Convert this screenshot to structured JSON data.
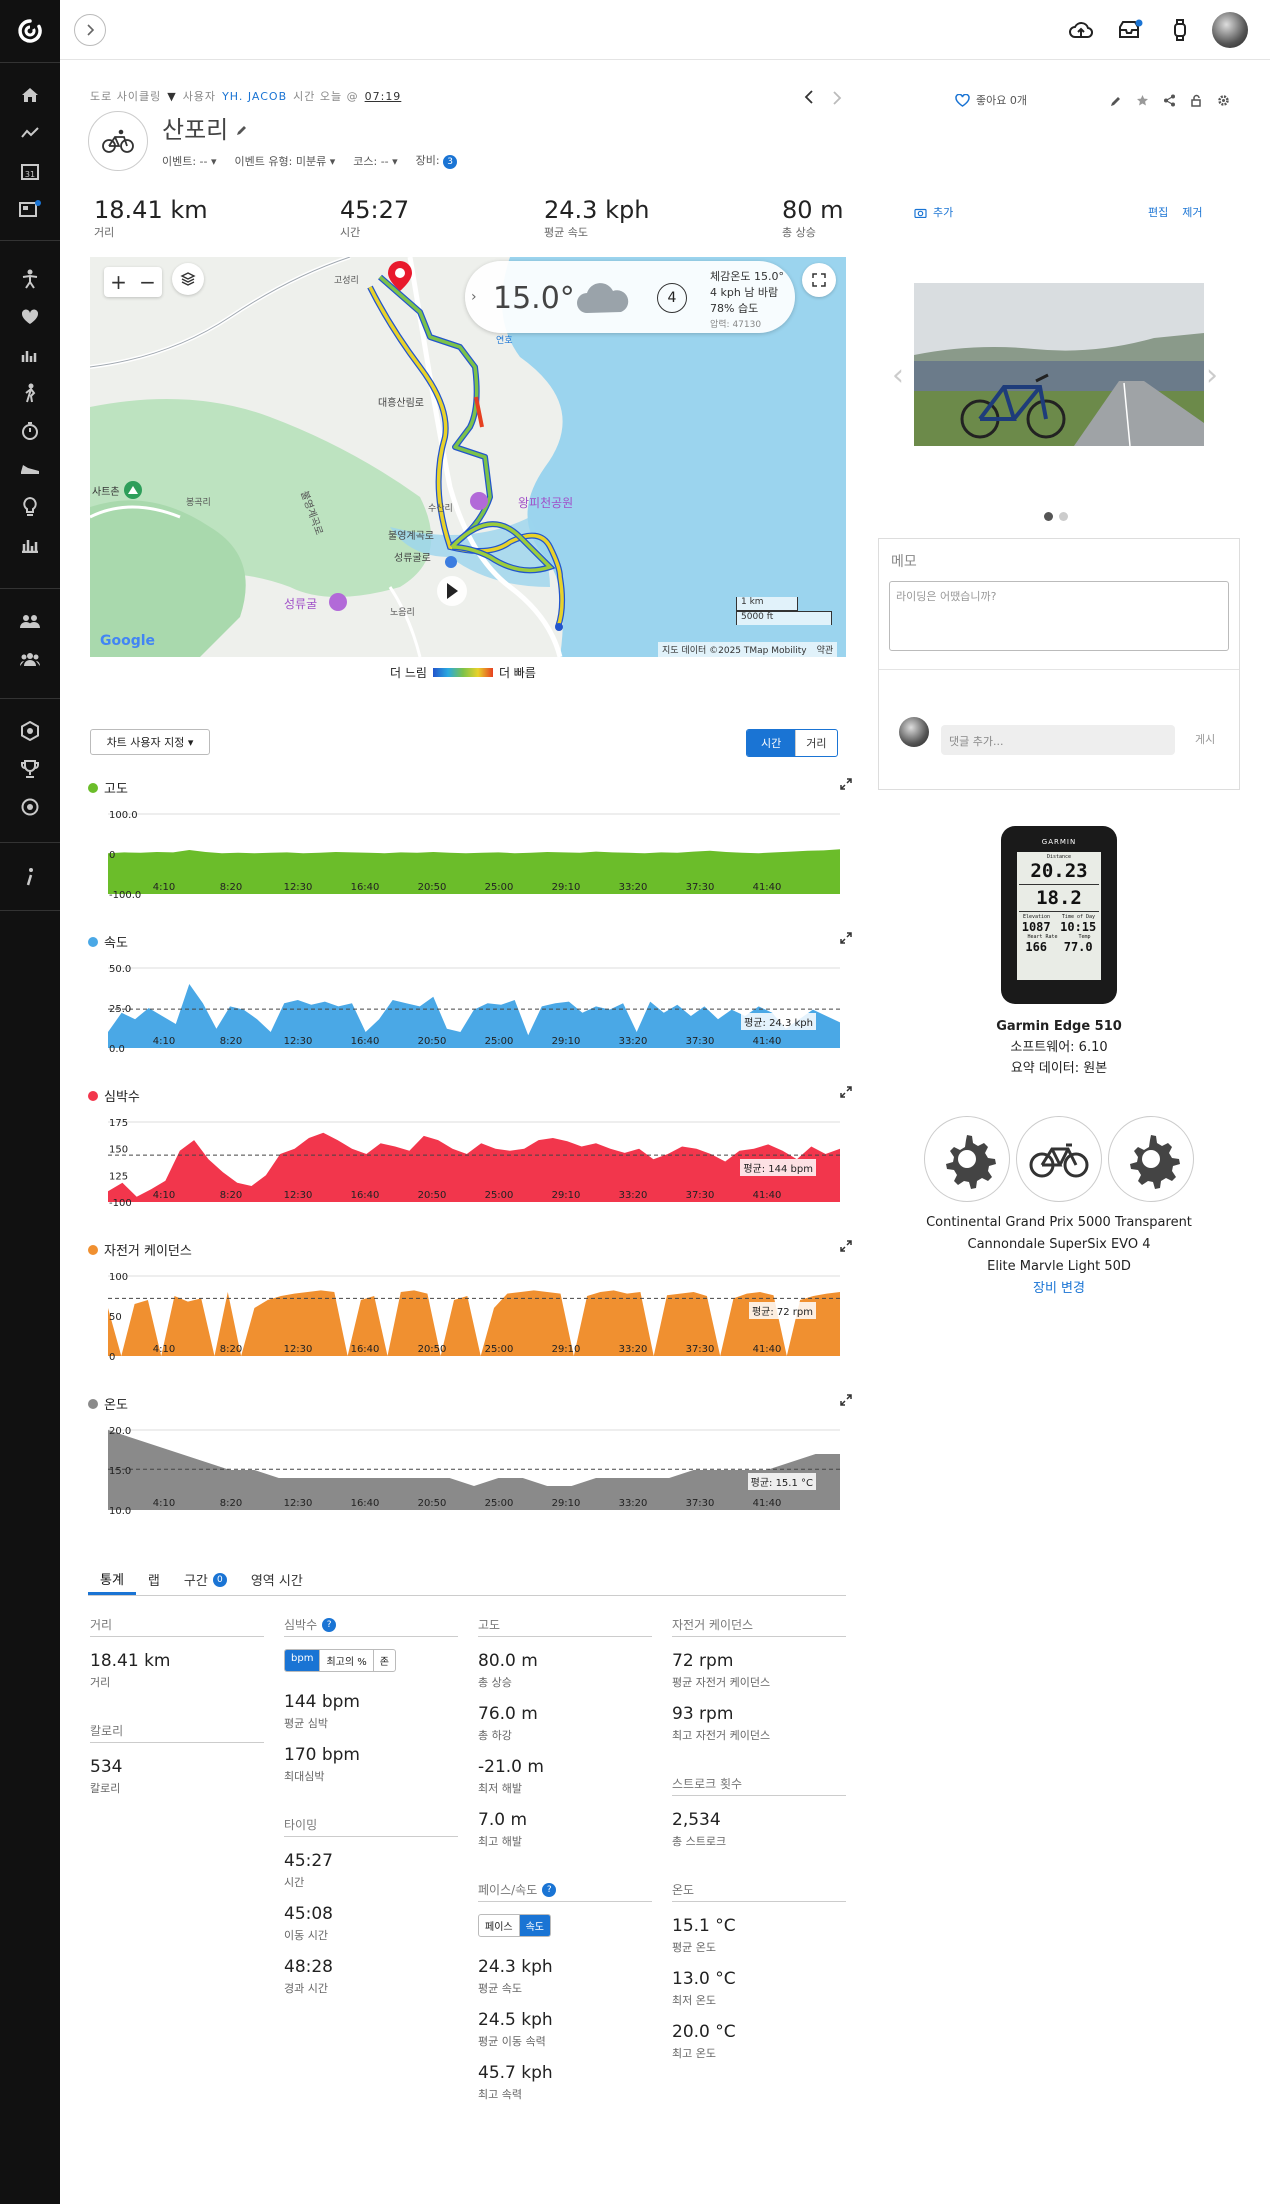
{
  "activity": {
    "breadcrumb_type": "도로 사이클링",
    "by_label": "사용자",
    "user": "YH. JACOB",
    "time_label": "시간 오늘 @",
    "time": "07:19",
    "title": "산포리",
    "event": "이벤트: --",
    "event_type": "이벤트 유형: 미분류",
    "course": "코스: --",
    "gear_label": "장비:",
    "gear_count": "3",
    "likes": "좋아요 0개"
  },
  "summary": [
    {
      "value": "18.41 km",
      "label": "거리"
    },
    {
      "value": "45:27",
      "label": "시간"
    },
    {
      "value": "24.3 kph",
      "label": "평균 속도"
    },
    {
      "value": "80 m",
      "label": "총 상승"
    }
  ],
  "weather": {
    "temp": "15.0°",
    "feels": "체감온도 15.0°",
    "wind": "4 kph 남 바람",
    "humidity": "78% 습도",
    "pressure": "압력: 47130",
    "wind_speed": "4"
  },
  "map": {
    "labels": [
      "고성리",
      "대흥산림로",
      "봉곡리",
      "사트촌",
      "불영계곡로",
      "불영계곡로",
      "성류굴로",
      "성류굴",
      "노음리",
      "왕피천공원",
      "수산리",
      "연호"
    ],
    "scale_km": "1 km",
    "scale_ft": "5000 ft",
    "attribution": "지도 데이터 ©2025 TMap Mobility",
    "terms": "약관",
    "google": "Google",
    "legend_slow": "더 느림",
    "legend_fast": "더 빠름"
  },
  "chart_controls": {
    "customize": "차트 사용자 지정 ▾",
    "time": "시간",
    "distance": "거리"
  },
  "chart_data": [
    {
      "type": "area",
      "title": "고도",
      "color": "#6bbd2a",
      "ymin": -100,
      "ymax": 100,
      "yticks": [
        "100.0",
        "0",
        "-100.0"
      ],
      "x_ticks": [
        "4:10",
        "8:20",
        "12:30",
        "16:40",
        "20:50",
        "25:00",
        "29:10",
        "33:20",
        "37:30",
        "41:40"
      ],
      "values": [
        2,
        4,
        3,
        5,
        4,
        10,
        5,
        2,
        3,
        2,
        3,
        4,
        2,
        3,
        5,
        4,
        3,
        2,
        4,
        3,
        5,
        3,
        2,
        3,
        4,
        2,
        3,
        5,
        4,
        3,
        6,
        4,
        3,
        2,
        4,
        3,
        6,
        8,
        5,
        3,
        2,
        4,
        6,
        8,
        9,
        12
      ]
    },
    {
      "type": "area",
      "title": "속도",
      "color": "#4aa8e6",
      "ymin": 0,
      "ymax": 50,
      "yticks": [
        "50.0",
        "25.0",
        "0.0"
      ],
      "avg": 24.3,
      "avg_label": "평균: 24.3 kph",
      "x_ticks": [
        "4:10",
        "8:20",
        "12:30",
        "16:40",
        "20:50",
        "25:00",
        "29:10",
        "33:20",
        "37:30",
        "41:40"
      ],
      "values": [
        10,
        22,
        18,
        25,
        20,
        15,
        40,
        28,
        12,
        26,
        24,
        18,
        10,
        28,
        30,
        27,
        29,
        26,
        28,
        10,
        18,
        30,
        28,
        26,
        32,
        12,
        10,
        24,
        28,
        27,
        30,
        8,
        26,
        28,
        29,
        22,
        26,
        24,
        28,
        10,
        29,
        22,
        27,
        20,
        26,
        18,
        24,
        20,
        26,
        22,
        12,
        18,
        24,
        20,
        16
      ]
    },
    {
      "type": "area",
      "title": "심박수",
      "color": "#f2364c",
      "ymin": 100,
      "ymax": 175,
      "yticks": [
        "175",
        "150",
        "125",
        "-100"
      ],
      "avg": 144,
      "avg_label": "평균: 144 bpm",
      "x_ticks": [
        "4:10",
        "8:20",
        "12:30",
        "16:40",
        "20:50",
        "25:00",
        "29:10",
        "33:20",
        "37:30",
        "41:40"
      ],
      "values": [
        110,
        118,
        105,
        112,
        120,
        148,
        158,
        140,
        128,
        118,
        115,
        125,
        145,
        150,
        160,
        165,
        158,
        150,
        145,
        155,
        152,
        148,
        162,
        158,
        150,
        145,
        155,
        150,
        148,
        150,
        158,
        160,
        157,
        152,
        155,
        150,
        146,
        150,
        140,
        145,
        152,
        150,
        145,
        138,
        148,
        150,
        154,
        148,
        140,
        152,
        145,
        150
      ]
    },
    {
      "type": "area",
      "title": "자전거 케이던스",
      "color": "#f09030",
      "ymin": 0,
      "ymax": 100,
      "yticks": [
        "100",
        "50",
        "0"
      ],
      "avg": 72,
      "avg_label": "평균: 72 rpm",
      "x_ticks": [
        "4:10",
        "8:20",
        "12:30",
        "16:40",
        "20:50",
        "25:00",
        "29:10",
        "33:20",
        "37:30",
        "41:40"
      ],
      "values": [
        60,
        0,
        65,
        70,
        0,
        75,
        68,
        72,
        0,
        80,
        0,
        60,
        70,
        75,
        78,
        80,
        82,
        80,
        0,
        70,
        75,
        0,
        80,
        82,
        78,
        0,
        70,
        75,
        0,
        60,
        78,
        80,
        82,
        80,
        78,
        0,
        75,
        80,
        82,
        78,
        80,
        0,
        76,
        78,
        80,
        75,
        0,
        72,
        78,
        80,
        76,
        0,
        70,
        75,
        78,
        80
      ]
    },
    {
      "type": "area",
      "title": "온도",
      "color": "#8a8a8a",
      "ymin": 10,
      "ymax": 20,
      "yticks": [
        "20.0",
        "15.0",
        "10.0"
      ],
      "avg": 15.1,
      "avg_label": "평균: 15.1 °C",
      "x_ticks": [
        "4:10",
        "8:20",
        "12:30",
        "16:40",
        "20:50",
        "25:00",
        "29:10",
        "33:20",
        "37:30",
        "41:40"
      ],
      "values": [
        20,
        19,
        18,
        17,
        16,
        15,
        15,
        14,
        14,
        14,
        14,
        14,
        14,
        14,
        14,
        13,
        14,
        14,
        13,
        13,
        14,
        14,
        14,
        14,
        15,
        15,
        15,
        15,
        16,
        17,
        17
      ]
    }
  ],
  "tabs": [
    "통계",
    "랩",
    "구간",
    "영역 시간"
  ],
  "tab_badge": "0",
  "stats": {
    "distance": {
      "head": "거리",
      "value": "18.41 km",
      "label": "거리"
    },
    "calories": {
      "head": "칼로리",
      "value": "534",
      "label": "칼로리"
    },
    "hr": {
      "head": "심박수",
      "seg": [
        "bpm",
        "최고의 %",
        "존"
      ],
      "avg": "144 bpm",
      "avg_label": "평균 심박",
      "max": "170 bpm",
      "max_label": "최대심박"
    },
    "timing": {
      "head": "타이밍",
      "time": "45:27",
      "time_label": "시간",
      "moving": "45:08",
      "moving_label": "이동 시간",
      "elapsed": "48:28",
      "elapsed_label": "경과 시간"
    },
    "elev": {
      "head": "고도",
      "gain": "80.0 m",
      "gain_label": "총 상승",
      "loss": "76.0 m",
      "loss_label": "총 하강",
      "min": "-21.0 m",
      "min_label": "최저 해발",
      "max": "7.0 m",
      "max_label": "최고 해발"
    },
    "pace": {
      "head": "페이스/속도",
      "seg": [
        "페이스",
        "속도"
      ],
      "avg": "24.3 kph",
      "avg_label": "평균 속도",
      "moving": "24.5 kph",
      "moving_label": "평균 이동 속력",
      "max": "45.7 kph",
      "max_label": "최고 속력"
    },
    "cad": {
      "head": "자전거 케이던스",
      "avg": "72 rpm",
      "avg_label": "평균 자전거 케이던스",
      "max": "93 rpm",
      "max_label": "최고 자전거 케이던스"
    },
    "stroke": {
      "head": "스트로크 횟수",
      "value": "2,534",
      "label": "총 스트로크"
    },
    "temp": {
      "head": "온도",
      "avg": "15.1 °C",
      "avg_label": "평균 온도",
      "min": "13.0 °C",
      "min_label": "최저 온도",
      "max": "20.0 °C",
      "max_label": "최고 온도"
    }
  },
  "photo": {
    "add": "추가",
    "edit": "편집",
    "remove": "제거"
  },
  "memo": {
    "title": "메모",
    "placeholder": "라이딩은 어땠습니까?"
  },
  "comment": {
    "placeholder": "댓글 추가...",
    "post": "게시"
  },
  "device": {
    "name": "Garmin Edge 510",
    "software": "소프트웨어: 6.10",
    "summary": "요약 데이터: 원본",
    "screen": {
      "brand": "GARMIN",
      "top_label": "Distance",
      "v1": "20.23",
      "v2": "18.2",
      "l1": "Elevation",
      "l2": "Time of Day",
      "v3": "1087",
      "v4": "10:15",
      "l3": "Heart Rate",
      "l4": "Temp",
      "v5": "166",
      "v6": "77.0"
    }
  },
  "gear": {
    "items": [
      "Continental Grand Prix 5000 Transparent",
      "Cannondale SuperSix EVO 4",
      "Elite Marvle Light 50D"
    ],
    "change": "장비 변경"
  }
}
